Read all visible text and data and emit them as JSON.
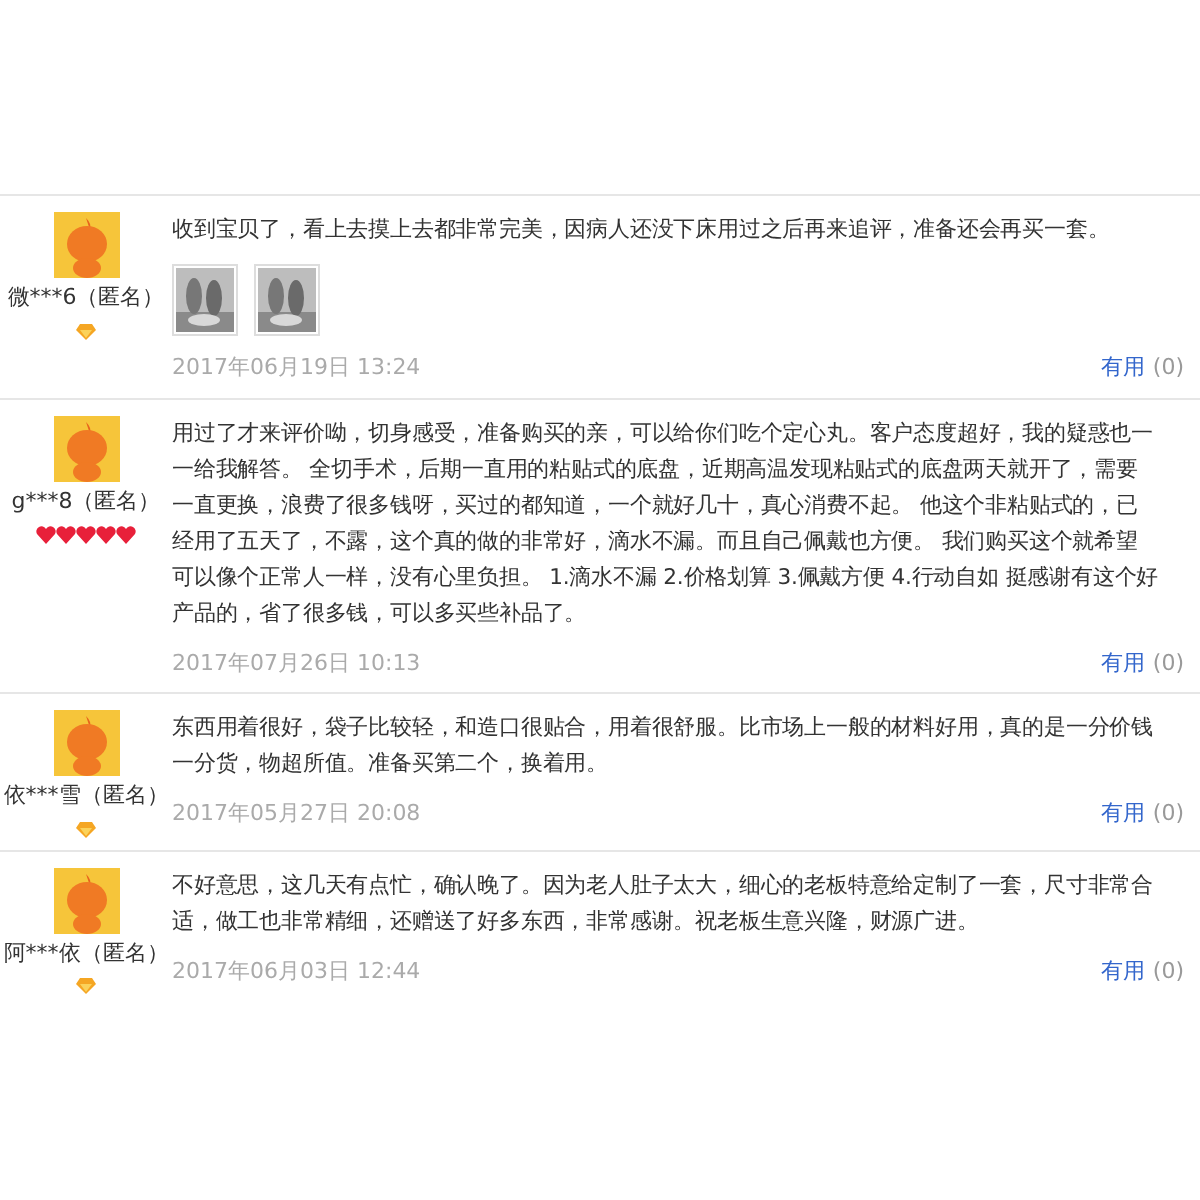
{
  "reviews": [
    {
      "user": "微***6（匿名）",
      "rank_icons": [
        {
          "kind": "diamond"
        }
      ],
      "lines": [
        "收到宝贝了，看上去摸上去都非常完美，因病人还没下床用过之后再来追评，准备还会再买一套。"
      ],
      "photos": [
        {
          "kind": "picture"
        },
        {
          "kind": "picture"
        }
      ],
      "date": "2017年06月19日 13:24",
      "useful": "有用",
      "useful_count": "(0)"
    },
    {
      "user": "g***8（匿名）",
      "rank_icons": [
        {
          "kind": "heart"
        },
        {
          "kind": "heart"
        },
        {
          "kind": "heart"
        },
        {
          "kind": "heart"
        },
        {
          "kind": "heart"
        }
      ],
      "lines": [
        "用过了才来评价呦，切身感受，准备购买的亲，可以给你们吃个定心丸。客户态度超好，我的疑惑也一",
        "一给我解答。 全切手术，后期一直用的粘贴式的底盘，近期高温发现粘贴式的底盘两天就开了，需要",
        "一直更换，浪费了很多钱呀，买过的都知道，一个就好几十，真心消费不起。 他这个非粘贴式的，已",
        "经用了五天了，不露，这个真的做的非常好，滴水不漏。而且自己佩戴也方便。 我们购买这个就希望",
        "可以像个正常人一样，没有心里负担。 1.滴水不漏 2.价格划算 3.佩戴方便 4.行动自如 挺感谢有这个好",
        "产品的，省了很多钱，可以多买些补品了。"
      ],
      "date": "2017年07月26日 10:13",
      "useful": "有用",
      "useful_count": "(0)"
    },
    {
      "user": "依***雪（匿名）",
      "rank_icons": [
        {
          "kind": "diamond"
        }
      ],
      "lines": [
        "东西用着很好，袋子比较轻，和造口很贴合，用着很舒服。比市场上一般的材料好用，真的是一分价钱",
        "一分货，物超所值。准备买第二个，换着用。"
      ],
      "date": "2017年05月27日 20:08",
      "useful": "有用",
      "useful_count": "(0)"
    },
    {
      "user": "阿***依（匿名）",
      "rank_icons": [
        {
          "kind": "diamond"
        }
      ],
      "lines": [
        "不好意思，这几天有点忙，确认晚了。因为老人肚子太大，细心的老板特意给定制了一套，尺寸非常合",
        "适，做工也非常精细，还赠送了好多东西，非常感谢。祝老板生意兴隆，财源广进。"
      ],
      "date": "2017年06月03日 12:44",
      "useful": "有用",
      "useful_count": "(0)"
    }
  ]
}
